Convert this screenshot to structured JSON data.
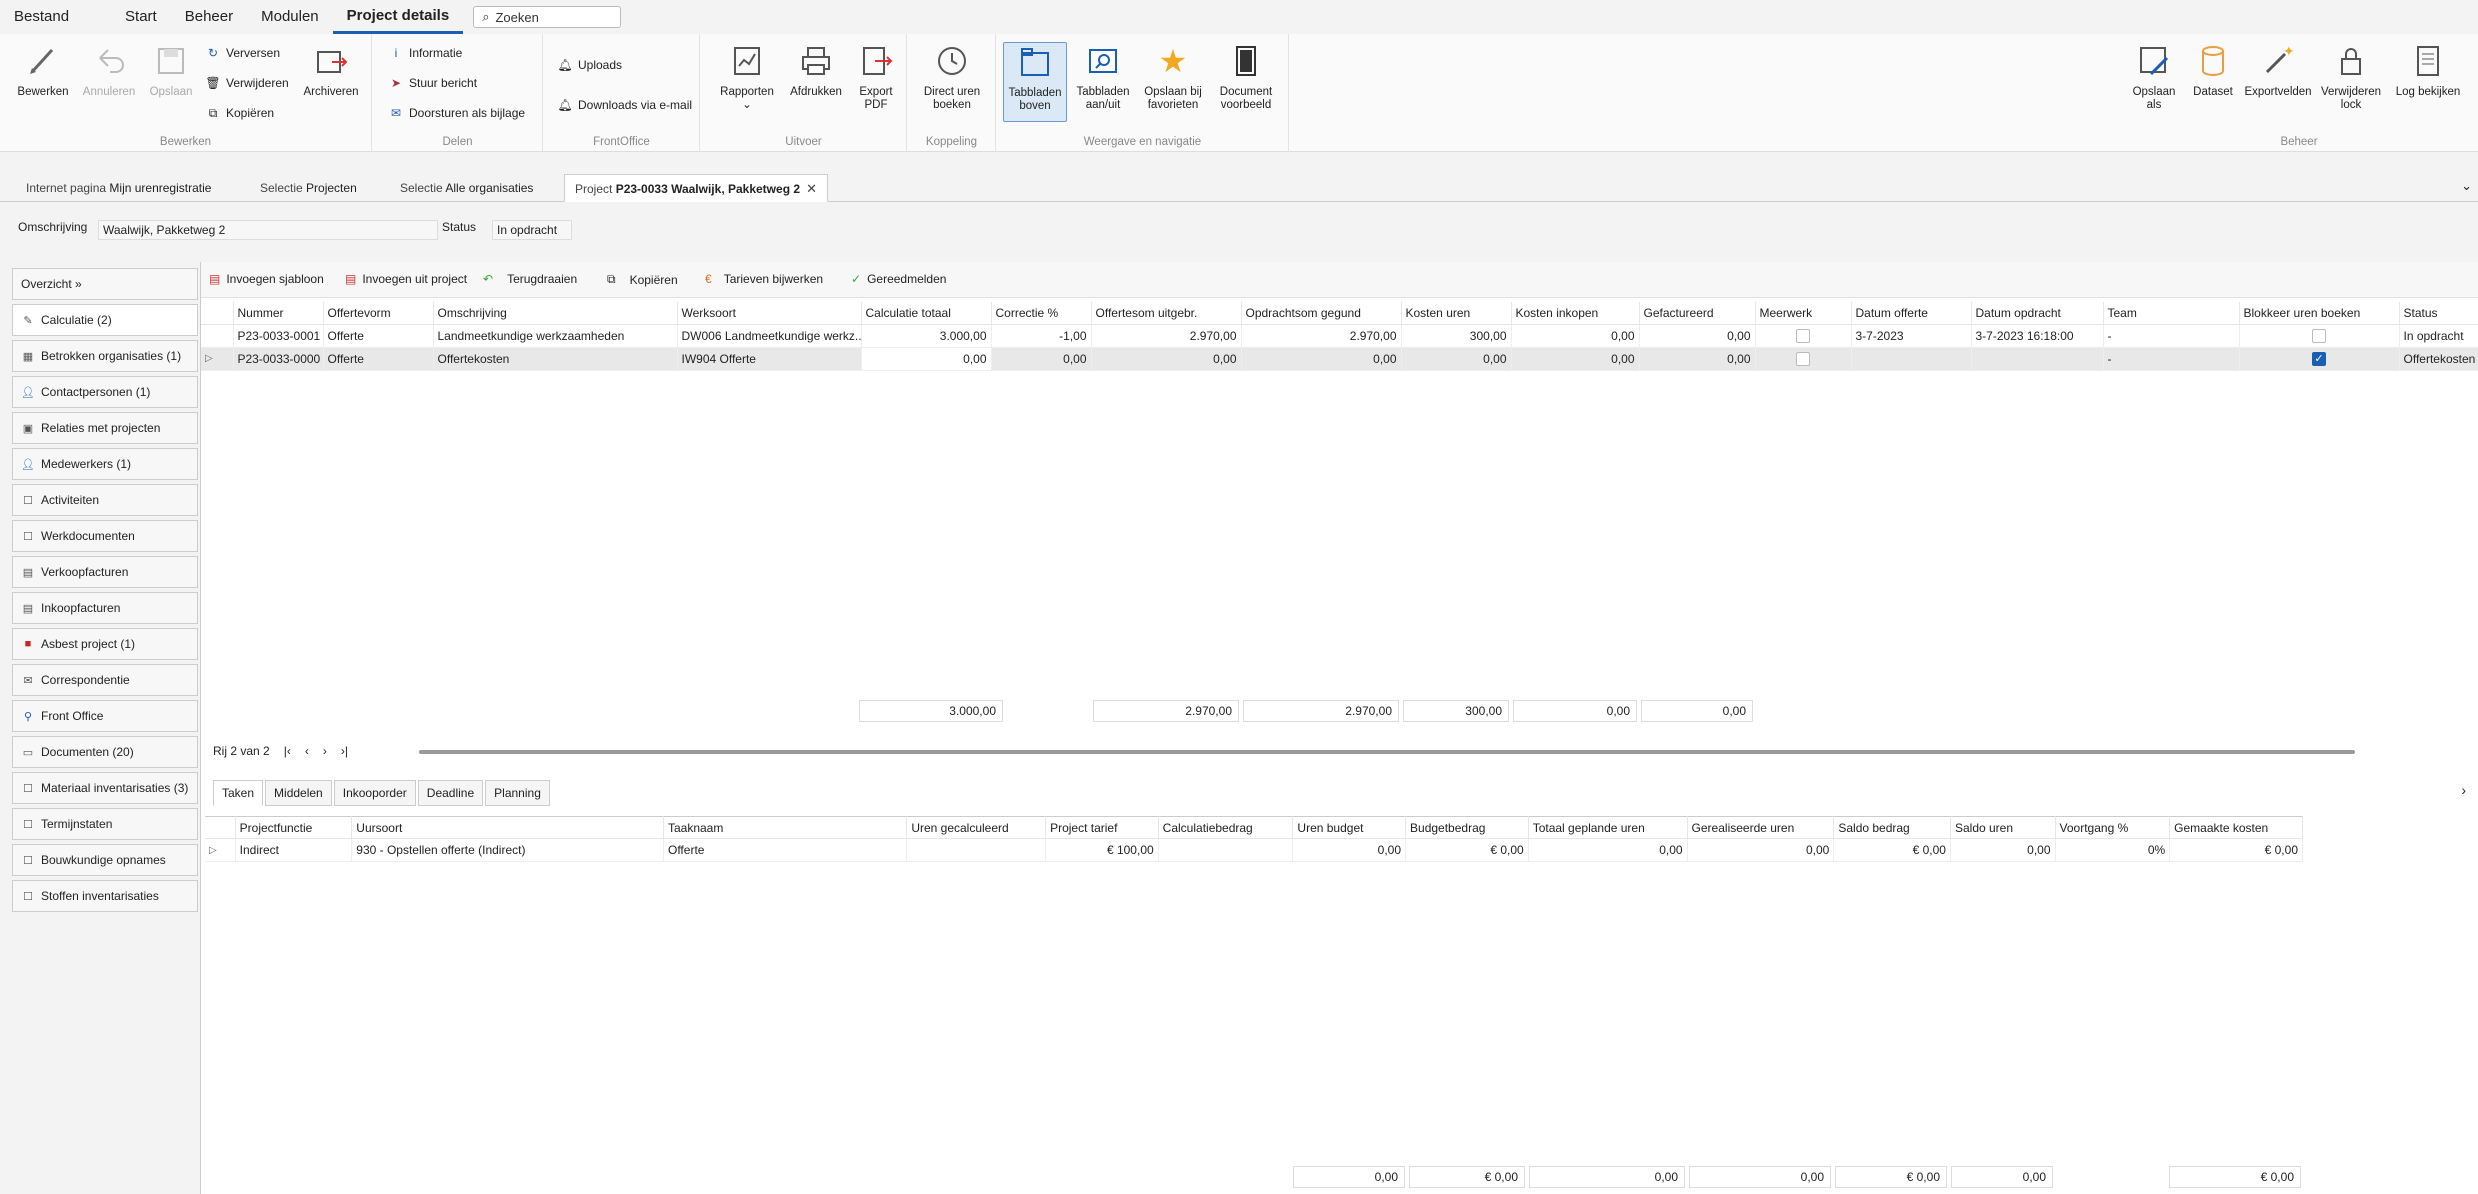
{
  "menubar": {
    "items": [
      "Bestand",
      "Start",
      "Beheer",
      "Modulen",
      "Project details"
    ],
    "search_placeholder": "Zoeken"
  },
  "ribbon": {
    "bewerken_group": "Bewerken",
    "bewerken": "Bewerken",
    "annuleren": "Annuleren",
    "opslaan": "Opslaan",
    "verversen": "Verversen",
    "verwijderen": "Verwijderen",
    "kopieren": "Kopiëren",
    "archiveren": "Archiveren",
    "delen_group": "Delen",
    "informatie": "Informatie",
    "stuur_bericht": "Stuur bericht",
    "doorsturen": "Doorsturen als bijlage",
    "frontoffice_group": "FrontOffice",
    "uploads": "Uploads",
    "downloads": "Downloads via e-mail",
    "uitvoer_group": "Uitvoer",
    "rapporten": "Rapporten",
    "afdrukken": "Afdrukken",
    "export_pdf": "Export PDF",
    "koppeling_group": "Koppeling",
    "direct_uren": "Direct uren boeken",
    "weergave_group": "Weergave en navigatie",
    "tabbladen_boven": "Tabbladen boven",
    "tabbladen_aanuit": "Tabbladen aan/uit",
    "opslaan_favorieten": "Opslaan bij favorieten",
    "document_voorbeeld": "Document voorbeeld",
    "beheer_group": "Beheer",
    "opslaan_als": "Opslaan als",
    "dataset": "Dataset",
    "exportvelden": "Exportvelden",
    "verwijderen_lock": "Verwijderen lock",
    "log_bekijken": "Log bekijken"
  },
  "doctabs": [
    {
      "prefix": "Internet pagina",
      "name": "Mijn urenregistratie"
    },
    {
      "prefix": "Selectie",
      "name": "Projecten"
    },
    {
      "prefix": "Selectie",
      "name": "Alle organisaties"
    },
    {
      "prefix": "Project",
      "name": "P23-0033 Waalwijk, Pakketweg 2"
    }
  ],
  "header": {
    "omschrijving_label": "Omschrijving",
    "omschrijving": "Waalwijk, Pakketweg 2",
    "status_label": "Status",
    "status": "In opdracht"
  },
  "sidebar": [
    "Overzicht »",
    "Calculatie (2)",
    "Betrokken organisaties (1)",
    "Contactpersonen (1)",
    "Relaties met projecten",
    "Medewerkers (1)",
    "Activiteiten",
    "Werkdocumenten",
    "Verkoopfacturen",
    "Inkoopfacturen",
    "Asbest project (1)",
    "Correspondentie",
    "Front Office",
    "Documenten (20)",
    "Materiaal inventarisaties (3)",
    "Termijnstaten",
    "Bouwkundige opnames",
    "Stoffen inventarisaties"
  ],
  "toolbar": {
    "sjabloon": "Invoegen sjabloon",
    "uit_project": "Invoegen uit project",
    "terugdraaien": "Terugdraaien",
    "kopieren": "Kopiëren",
    "tarieven": "Tarieven bijwerken",
    "gereedmelden": "Gereedmelden"
  },
  "grid": {
    "headers": [
      "Nummer",
      "Offertevorm",
      "Omschrijving",
      "Werksoort",
      "Calculatie totaal",
      "Correctie %",
      "Offertesom uitgebr.",
      "Opdrachtsom gegund",
      "Kosten uren",
      "Kosten inkopen",
      "Gefactureerd",
      "Meerwerk",
      "Datum offerte",
      "Datum opdracht",
      "Team",
      "Blokkeer uren boeken",
      "Status"
    ],
    "rows": [
      [
        "P23-0033-0001",
        "Offerte",
        "Landmeetkundige werkzaamheden",
        "DW006 Landmeetkundige werkz...",
        "3.000,00",
        "-1,00",
        "2.970,00",
        "2.970,00",
        "300,00",
        "0,00",
        "0,00",
        "",
        "3-7-2023",
        "3-7-2023 16:18:00",
        "-",
        "",
        "In opdracht"
      ],
      [
        "P23-0033-0000",
        "Offerte",
        "Offertekosten",
        "IW904 Offerte",
        "0,00",
        "0,00",
        "0,00",
        "0,00",
        "0,00",
        "0,00",
        "0,00",
        "",
        "",
        "",
        "-",
        "",
        "Offertekosten"
      ]
    ],
    "totals": {
      "calc": "3.000,00",
      "offertesom": "2.970,00",
      "opdrachtsom": "2.970,00",
      "kosten_uren": "300,00",
      "kosten_inkopen": "0,00",
      "gefactureerd": "0,00"
    }
  },
  "nav": {
    "row": "Rij 2 van 2"
  },
  "bottom_tabs": [
    "Taken",
    "Middelen",
    "Inkooporder",
    "Deadline",
    "Planning"
  ],
  "tasks": {
    "headers": [
      "Projectfunctie",
      "Uursoort",
      "Taaknaam",
      "Uren gecalculeerd",
      "Project tarief",
      "Calculatiebedrag",
      "Uren budget",
      "Budgetbedrag",
      "Totaal geplande uren",
      "Gerealiseerde uren",
      "Saldo bedrag",
      "Saldo uren",
      "Voortgang %",
      "Gemaakte kosten"
    ],
    "rows": [
      [
        "Indirect",
        "930 - Opstellen offerte  (Indirect)",
        "Offerte",
        "",
        "€ 100,00",
        "",
        "0,00",
        "€ 0,00",
        "0,00",
        "0,00",
        "€ 0,00",
        "0,00",
        "0%",
        "€ 0,00"
      ]
    ],
    "totals": [
      "0,00",
      "€ 0,00",
      "0,00",
      "0,00",
      "€ 0,00",
      "0,00",
      "€ 0,00"
    ]
  }
}
